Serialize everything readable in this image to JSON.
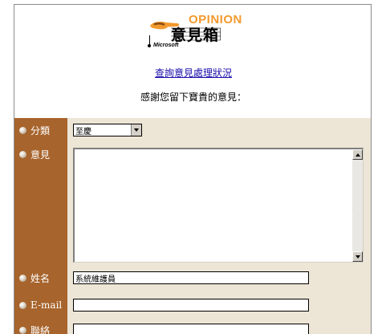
{
  "header": {
    "logo_opinion": "OPINION",
    "logo_title": "意見箱",
    "logo_company": "Microsoft"
  },
  "links": {
    "status": "查詢意見處理狀況"
  },
  "intro": {
    "thanks": "感謝您留下寶貴的意見："
  },
  "form": {
    "category_label": "分類",
    "category_value": "至慶",
    "opinion_label": "意見",
    "opinion_value": "",
    "name_label": "姓名",
    "name_value": "系統維護員",
    "email_label": "E-mail",
    "email_value": "",
    "phone_label": "聯絡",
    "phone_value": ""
  },
  "colors": {
    "label_column": "#a7642c",
    "form_background": "#ede5d5",
    "logo_accent": "#f29a2e",
    "link": "#1a0dab"
  }
}
